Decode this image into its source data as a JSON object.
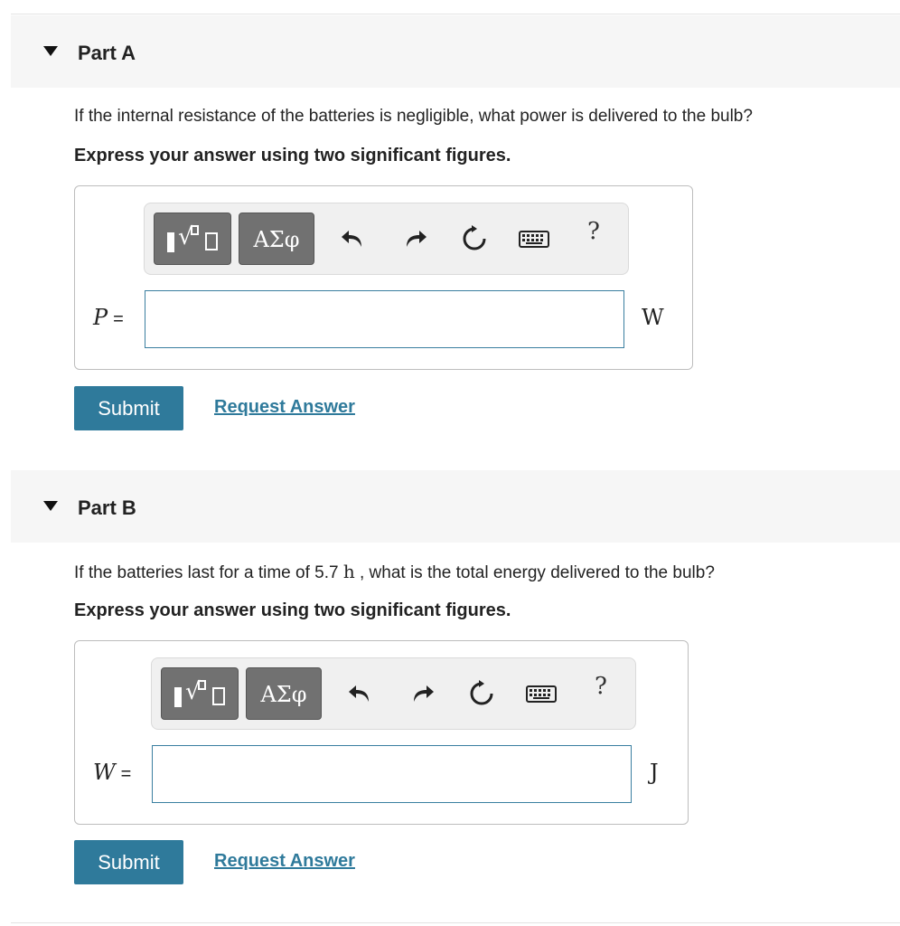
{
  "parts": [
    {
      "title": "Part A",
      "question": "If the internal resistance of the batteries is negligible, what power is delivered to the bulb?",
      "instruction": "Express your answer using two significant figures.",
      "variable": "P",
      "equals": "=",
      "unit": "W",
      "answer_value": "",
      "toolbar": {
        "symbols_label": "ΑΣφ",
        "help_label": "?"
      },
      "submit_label": "Submit",
      "request_label": "Request Answer"
    },
    {
      "title": "Part B",
      "question_prefix": "If the batteries last for a time of 5.7 ",
      "question_unit": "h",
      "question_suffix": " , what is the total energy delivered to the bulb?",
      "instruction": "Express your answer using two significant figures.",
      "variable": "W",
      "equals": "=",
      "unit": "J",
      "answer_value": "",
      "toolbar": {
        "symbols_label": "ΑΣφ",
        "help_label": "?"
      },
      "submit_label": "Submit",
      "request_label": "Request Answer"
    }
  ],
  "colors": {
    "accent": "#2f7a9b",
    "toolbar_button": "#717171",
    "header_bg": "#f6f6f6"
  },
  "icons": [
    "collapse-triangle-icon",
    "templates-icon",
    "undo-icon",
    "redo-icon",
    "reset-icon",
    "keyboard-icon",
    "help-icon"
  ]
}
